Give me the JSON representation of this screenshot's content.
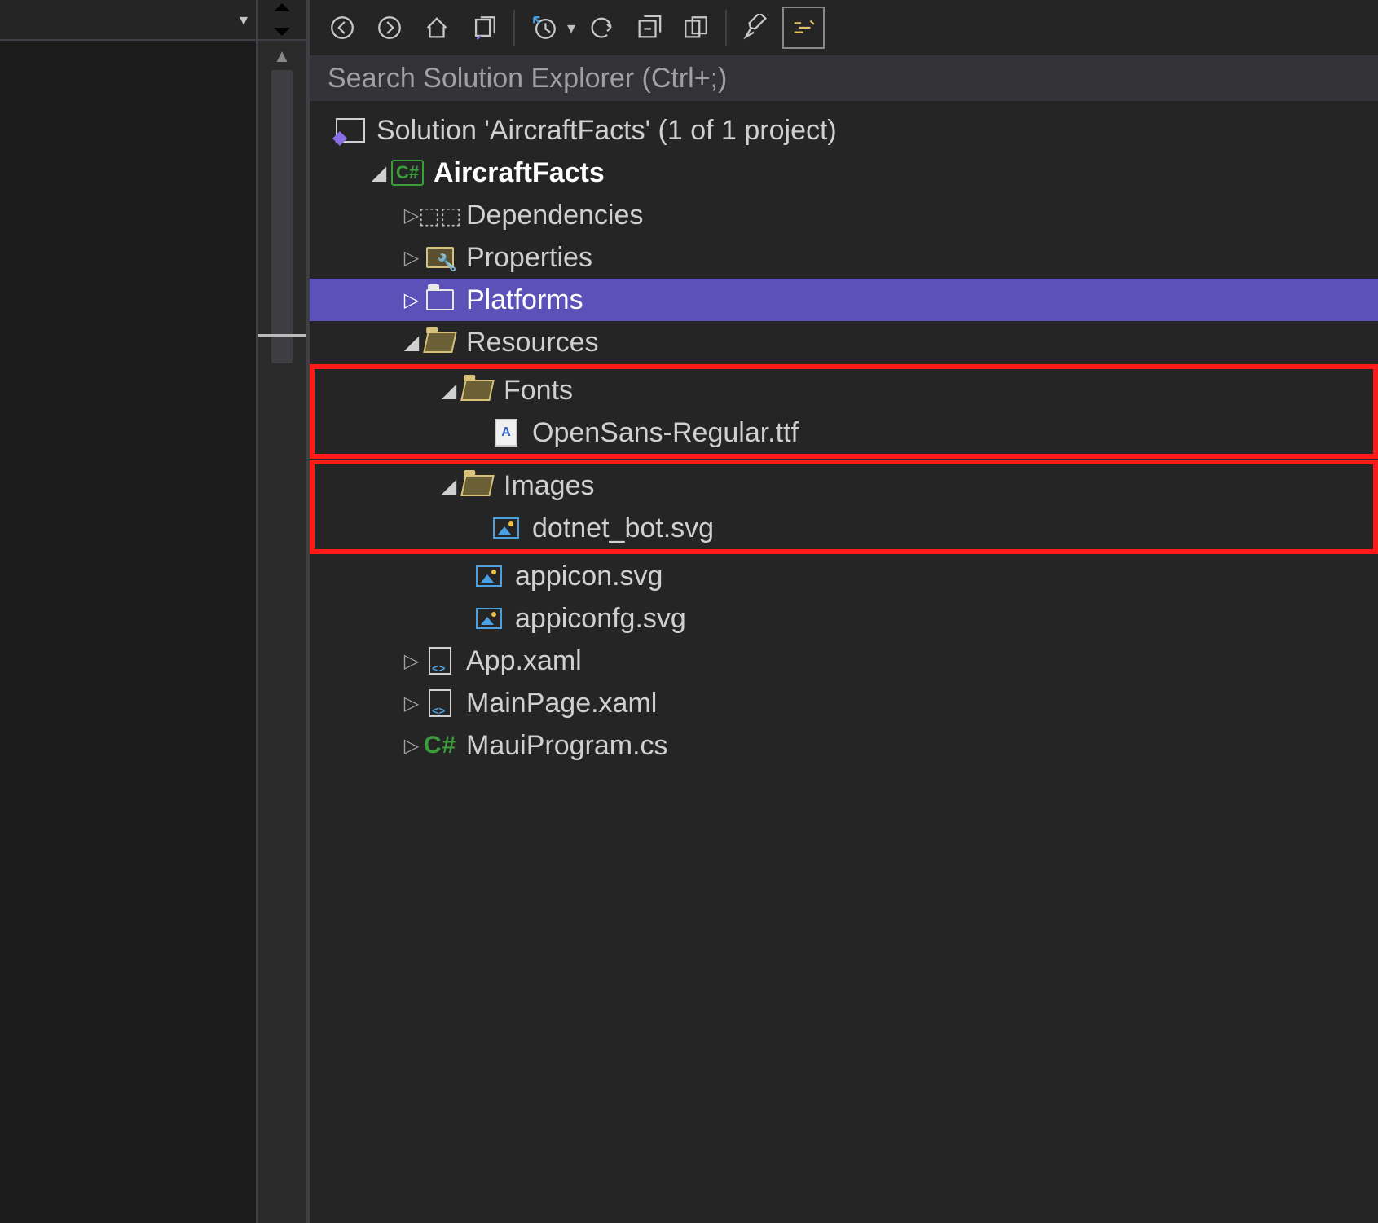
{
  "search": {
    "placeholder": "Search Solution Explorer (Ctrl+;)"
  },
  "solution": {
    "label": "Solution 'AircraftFacts' (1 of 1 project)"
  },
  "project": {
    "name": "AircraftFacts"
  },
  "nodes": {
    "dependencies": "Dependencies",
    "properties": "Properties",
    "platforms": "Platforms",
    "resources": "Resources",
    "fonts": "Fonts",
    "fontfile": "OpenSans-Regular.ttf",
    "images": "Images",
    "botfile": "dotnet_bot.svg",
    "appicon": "appicon.svg",
    "appiconfg": "appiconfg.svg",
    "appxaml": "App.xaml",
    "mainpage": "MainPage.xaml",
    "mauiprogram": "MauiProgram.cs"
  },
  "badges": {
    "csharp": "C#",
    "csharp_short": "C#",
    "font_letter": "A"
  }
}
